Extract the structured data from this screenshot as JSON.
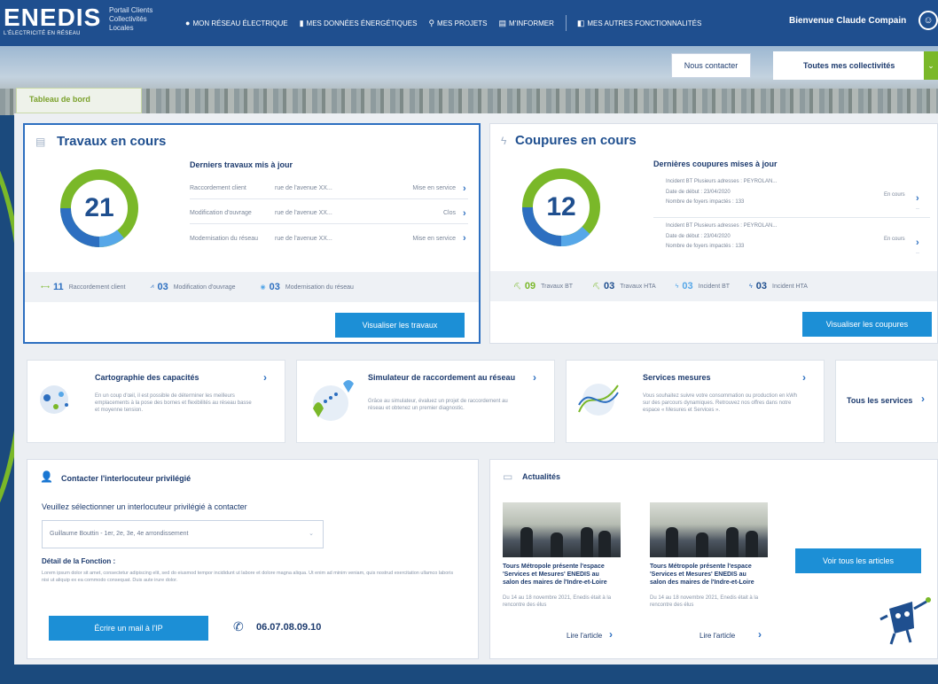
{
  "header": {
    "brand": "ENEDIS",
    "tagline": "L'ÉLECTRICITÉ EN RÉSEAU",
    "portal_label": "Portail Clients Collectivités Locales",
    "nav": [
      {
        "icon": "pin-icon",
        "label": "Mon réseau électrique"
      },
      {
        "icon": "bar-chart-icon",
        "label": "Mes données énergétiques"
      },
      {
        "icon": "location-icon",
        "label": "Mes projets"
      },
      {
        "icon": "book-icon",
        "label": "M'informer"
      },
      {
        "icon": "window-icon",
        "label": "Mes autres fonctionnalités"
      }
    ],
    "welcome": "Bienvenue Claude Compain"
  },
  "hero": {
    "contact_button": "Nous contacter",
    "collectivity_select": "Toutes mes collectivités"
  },
  "dashboard_tab": "Tableau de bord",
  "travaux": {
    "title": "Travaux en cours",
    "count": "21",
    "subtitle": "Derniers travaux mis à jour",
    "rows": [
      {
        "type": "Raccordement client",
        "address": "rue de l'avenue XX...",
        "status": "Mise en service"
      },
      {
        "type": "Modification d'ouvrage",
        "address": "rue de l'avenue XX...",
        "status": "Clos"
      },
      {
        "type": "Modernisation du réseau",
        "address": "rue de l'avenue XX...",
        "status": "Mise en service"
      }
    ],
    "stats": [
      {
        "value": "11",
        "label": "Raccordement client"
      },
      {
        "value": "03",
        "label": "Modification d'ouvrage"
      },
      {
        "value": "03",
        "label": "Modernisation du réseau"
      }
    ],
    "button": "Visualiser les travaux"
  },
  "coupures": {
    "title": "Coupures en cours",
    "count": "12",
    "subtitle": "Dernières coupures mises à jour",
    "rows": [
      {
        "line1": "Incident BT    Plusieurs adresses : PEYROLAN...",
        "line2": "Date de début : 23/04/2020",
        "line3": "Nombre de foyers impactés : 133",
        "status": "En cours"
      },
      {
        "line1": "Incident BT    Plusieurs adresses : PEYROLAN...",
        "line2": "Date de début : 23/04/2020",
        "line3": "Nombre de foyers impactés : 133",
        "status": "En cours"
      }
    ],
    "stats": [
      {
        "value": "09",
        "label": "Travaux BT"
      },
      {
        "value": "03",
        "label": "Travaux HTA"
      },
      {
        "value": "03",
        "label": "Incident BT"
      },
      {
        "value": "03",
        "label": "Incident HTA"
      }
    ],
    "button": "Visualiser les coupures"
  },
  "services": [
    {
      "title": "Cartographie des capacités",
      "desc": "En un coup d'œil, il est possible de déterminer les meilleurs emplacements à la pose des bornes et flexibilités au réseau basse et moyenne tension."
    },
    {
      "title": "Simulateur de raccordement au réseau",
      "desc": "Grâce au simulateur, évaluez un projet de raccordement au réseau et obtenez un premier diagnostic."
    },
    {
      "title": "Services mesures",
      "desc": "Vous souhaitez suivre votre consommation ou production en kWh sur des parcours dynamiques. Retrouvez nos offres dans notre espace « Mesures et Services »."
    }
  ],
  "all_services": "Tous les services",
  "contact": {
    "title": "Contacter l'interlocuteur privilégié",
    "prompt": "Veuillez sélectionner un interlocuteur privilégié à contacter",
    "selected": "Guillaume Bouttin - 1er, 2e, 3e, 4e arrondissement",
    "detail_title": "Détail de la Fonction :",
    "detail_text": "Lorem ipsum dolor sit amet, consectetur adipiscing elit, sed do eiusmod tempor incididunt ut labore et dolore magna aliqua. Ut enim ad minim veniam, quis nostrud exercitation ullamco laboris nisi ut aliquip ex ea commodo consequat. Duis aute irure dolor.",
    "mail_button": "Écrire un mail à l'IP",
    "phone": "06.07.08.09.10"
  },
  "news": {
    "title": "Actualités",
    "articles": [
      {
        "title": "Tours Métropole présente l'espace 'Services et Mesures' ENEDIS au salon des maires de l'Indre-et-Loire",
        "date": "Du 14 au 18 novembre 2021, Enedis était à la rencontre des élus",
        "read": "Lire l'article"
      },
      {
        "title": "Tours Métropole présente l'espace 'Services et Mesures' ENEDIS au salon des maires de l'Indre-et-Loire",
        "date": "Du 14 au 18 novembre 2021, Enedis était à la rencontre des élus",
        "read": "Lire l'article"
      }
    ],
    "all_button": "Voir tous les articles"
  },
  "colors": {
    "brand_blue": "#1f4f8f",
    "accent_green": "#7ab829",
    "button_blue": "#1c8fd6"
  }
}
